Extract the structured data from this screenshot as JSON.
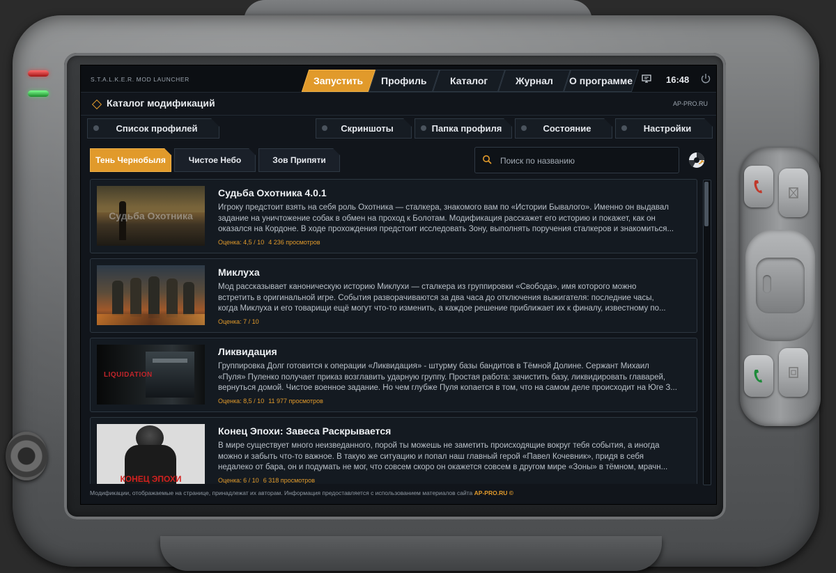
{
  "app": {
    "title": "S.T.A.L.K.E.R. MOD LAUNCHER",
    "clock": "16:48"
  },
  "nav": {
    "tabs": [
      {
        "label": "Запустить"
      },
      {
        "label": "Профиль"
      },
      {
        "label": "Каталог"
      },
      {
        "label": "Журнал"
      },
      {
        "label": "О программе"
      }
    ]
  },
  "header": {
    "title": "Каталог модификаций",
    "site": "AP-PRO.RU"
  },
  "subtabs": [
    {
      "label": "Список профилей"
    },
    {
      "label": "Скриншоты"
    },
    {
      "label": "Папка профиля"
    },
    {
      "label": "Состояние"
    },
    {
      "label": "Настройки"
    }
  ],
  "game_tabs": [
    {
      "label": "Тень Чернобыля"
    },
    {
      "label": "Чистое Небо"
    },
    {
      "label": "Зов Припяти"
    }
  ],
  "search": {
    "placeholder": "Поиск по названию"
  },
  "mods": [
    {
      "title": "Судьба Охотника 4.0.1",
      "thumb_text": "Судьба Охотника",
      "desc1": "Игроку предстоит взять на себя роль Охотника — сталкера, знакомого вам по «Истории Бывалого». Именно он выдавал",
      "desc2": "задание на уничтожение собак в обмен на проход к Болотам. Модификация расскажет его историю и покажет, как он",
      "desc3": "оказался на Кордоне. В ходе прохождения предстоит исследовать Зону, выполнять поручения сталкеров и знакомиться...",
      "rating": "Оценка: 4,5 / 10",
      "views": "4 236 просмотров"
    },
    {
      "title": "Миклуха",
      "thumb_text": "",
      "desc1": "Мод рассказывает каноническую историю Миклухи — сталкера из группировки «Свобода», имя которого можно",
      "desc2": "встретить в оригинальной игре. События разворачиваются за два часа до отключения выжигателя: последние часы,",
      "desc3": "когда Миклуха и его товарищи ещё могут что-то изменить, а каждое решение приближает их к финалу, известному по...",
      "rating": "Оценка: 7 / 10",
      "views": ""
    },
    {
      "title": "Ликвидация",
      "thumb_text": "LIQUIDATION",
      "desc1": "Группировка Долг готовится к операции «Ликвидация» - штурму базы бандитов в Тёмной Долине. Сержант Михаил",
      "desc2": "«Пуля» Пуленко получает приказ возглавить ударную группу. Простая работа: зачистить базу, ликвидировать главарей,",
      "desc3": "вернуться домой. Чистое военное задание. Но чем глубже Пуля копается в том, что на самом деле происходит на Юге З...",
      "rating": "Оценка: 8,5 / 10",
      "views": "11 977 просмотров"
    },
    {
      "title": "Конец Эпохи: Завеса Раскрывается",
      "thumb_text": "КОНЕЦ ЭПОХИ",
      "desc1": "В мире существует много неизведанного, порой ты можешь не заметить происходящие вокруг тебя события, а иногда",
      "desc2": "можно и забыть что-то важное. В такую же ситуацию и попал наш главный герой «Павел Кочевник», придя в себя",
      "desc3": "недалеко от бара, он и подумать не мог, что совсем скоро он окажется совсем в другом мире «Зоны» в тёмном, мрачн...",
      "rating": "Оценка: 6 / 10",
      "views": "6 318 просмотров"
    }
  ],
  "footer": {
    "text": "Модификации, отображаемые на странице, принадлежат их авторам. Информация предоставляется с использованием материалов сайта",
    "link": "AP-PRO.RU ©"
  },
  "colors": {
    "accent": "#e19a2b",
    "screen_bg": "#11151b",
    "card_bg": "#141a21"
  },
  "icons": [
    "monitor-icon",
    "power-icon",
    "search-icon",
    "refresh-icon",
    "diamond-icon",
    "phone-red-icon",
    "phone-green-icon"
  ]
}
